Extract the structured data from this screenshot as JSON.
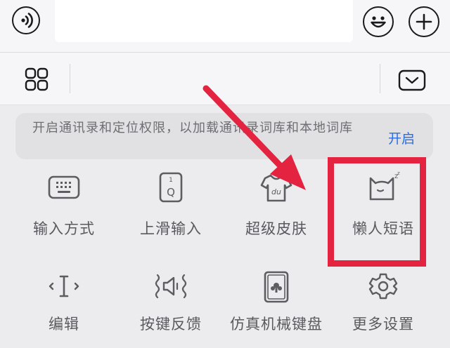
{
  "chat_bar": {
    "voice_icon": "voice-wave-icon",
    "input_value": "",
    "emoji_icon": "smiley-icon",
    "plus_icon": "plus-icon"
  },
  "toolbar": {
    "grid_icon": "grid-four-icon",
    "collapse_icon": "chevron-down-icon"
  },
  "banner": {
    "text": "开启通讯录和定位权限，以加载通讯录词库和本地词库",
    "action": "开启",
    "action_color": "#2a6de0"
  },
  "grid": {
    "row1": [
      {
        "label": "输入方式",
        "icon": "keyboard-icon"
      },
      {
        "label": "上滑输入",
        "icon": "swipe-up-key-icon"
      },
      {
        "label": "超级皮肤",
        "icon": "tshirt-skin-icon"
      },
      {
        "label": "懒人短语",
        "icon": "sleepy-cat-icon"
      }
    ],
    "row2": [
      {
        "label": "编辑",
        "icon": "text-cursor-icon"
      },
      {
        "label": "按键反馈",
        "icon": "speaker-vibration-icon"
      },
      {
        "label": "仿真机械键盘",
        "icon": "mechanical-key-icon"
      },
      {
        "label": "更多设置",
        "icon": "gear-icon"
      }
    ]
  },
  "annotation": {
    "color": "#e3233f",
    "target": "懒人短语"
  }
}
